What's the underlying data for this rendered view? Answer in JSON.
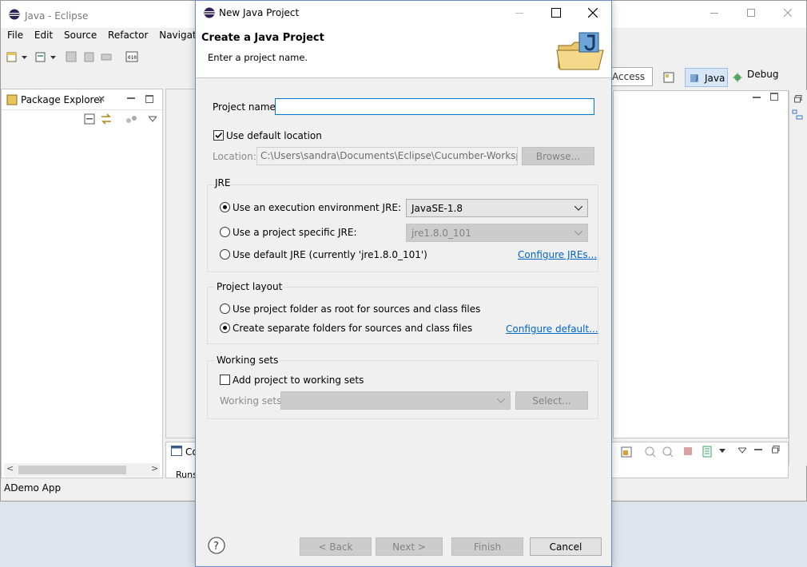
{
  "eclipse": {
    "title": "Java - Eclipse",
    "menu": [
      "File",
      "Edit",
      "Source",
      "Refactor",
      "Navigate"
    ],
    "quick_access": "Access",
    "perspective_java": "Java",
    "perspective_debug": "Debug",
    "package_explorer_tab": "Package Explorer",
    "console_tab": "Co",
    "console_line": "Runs",
    "status": "ADemo App"
  },
  "dialog": {
    "title": "New Java Project",
    "header_title": "Create a Java Project",
    "header_subtitle": "Enter a project name.",
    "project_name_label": "Project name:",
    "project_name_value": "",
    "use_default_location_label": "Use default location",
    "use_default_location_checked": true,
    "location_label": "Location:",
    "location_value": "C:\\Users\\sandra\\Documents\\Eclipse\\Cucumber-Workspace",
    "browse_label": "Browse...",
    "jre": {
      "group_title": "JRE",
      "option_env_label": "Use an execution environment JRE:",
      "option_env_value": "JavaSE-1.8",
      "option_specific_label": "Use a project specific JRE:",
      "option_specific_value": "jre1.8.0_101",
      "option_default_label": "Use default JRE (currently 'jre1.8.0_101')",
      "configure_link": "Configure JREs...",
      "selected": "option_env"
    },
    "layout": {
      "group_title": "Project layout",
      "option_root_label": "Use project folder as root for sources and class files",
      "option_separate_label": "Create separate folders for sources and class files",
      "configure_default_link": "Configure default...",
      "selected": "option_separate"
    },
    "working_sets": {
      "group_title": "Working sets",
      "add_label": "Add project to working sets",
      "add_checked": false,
      "sets_label": "Working sets:",
      "select_label": "Select..."
    },
    "buttons": {
      "back": "< Back",
      "next": "Next >",
      "finish": "Finish",
      "cancel": "Cancel"
    }
  }
}
